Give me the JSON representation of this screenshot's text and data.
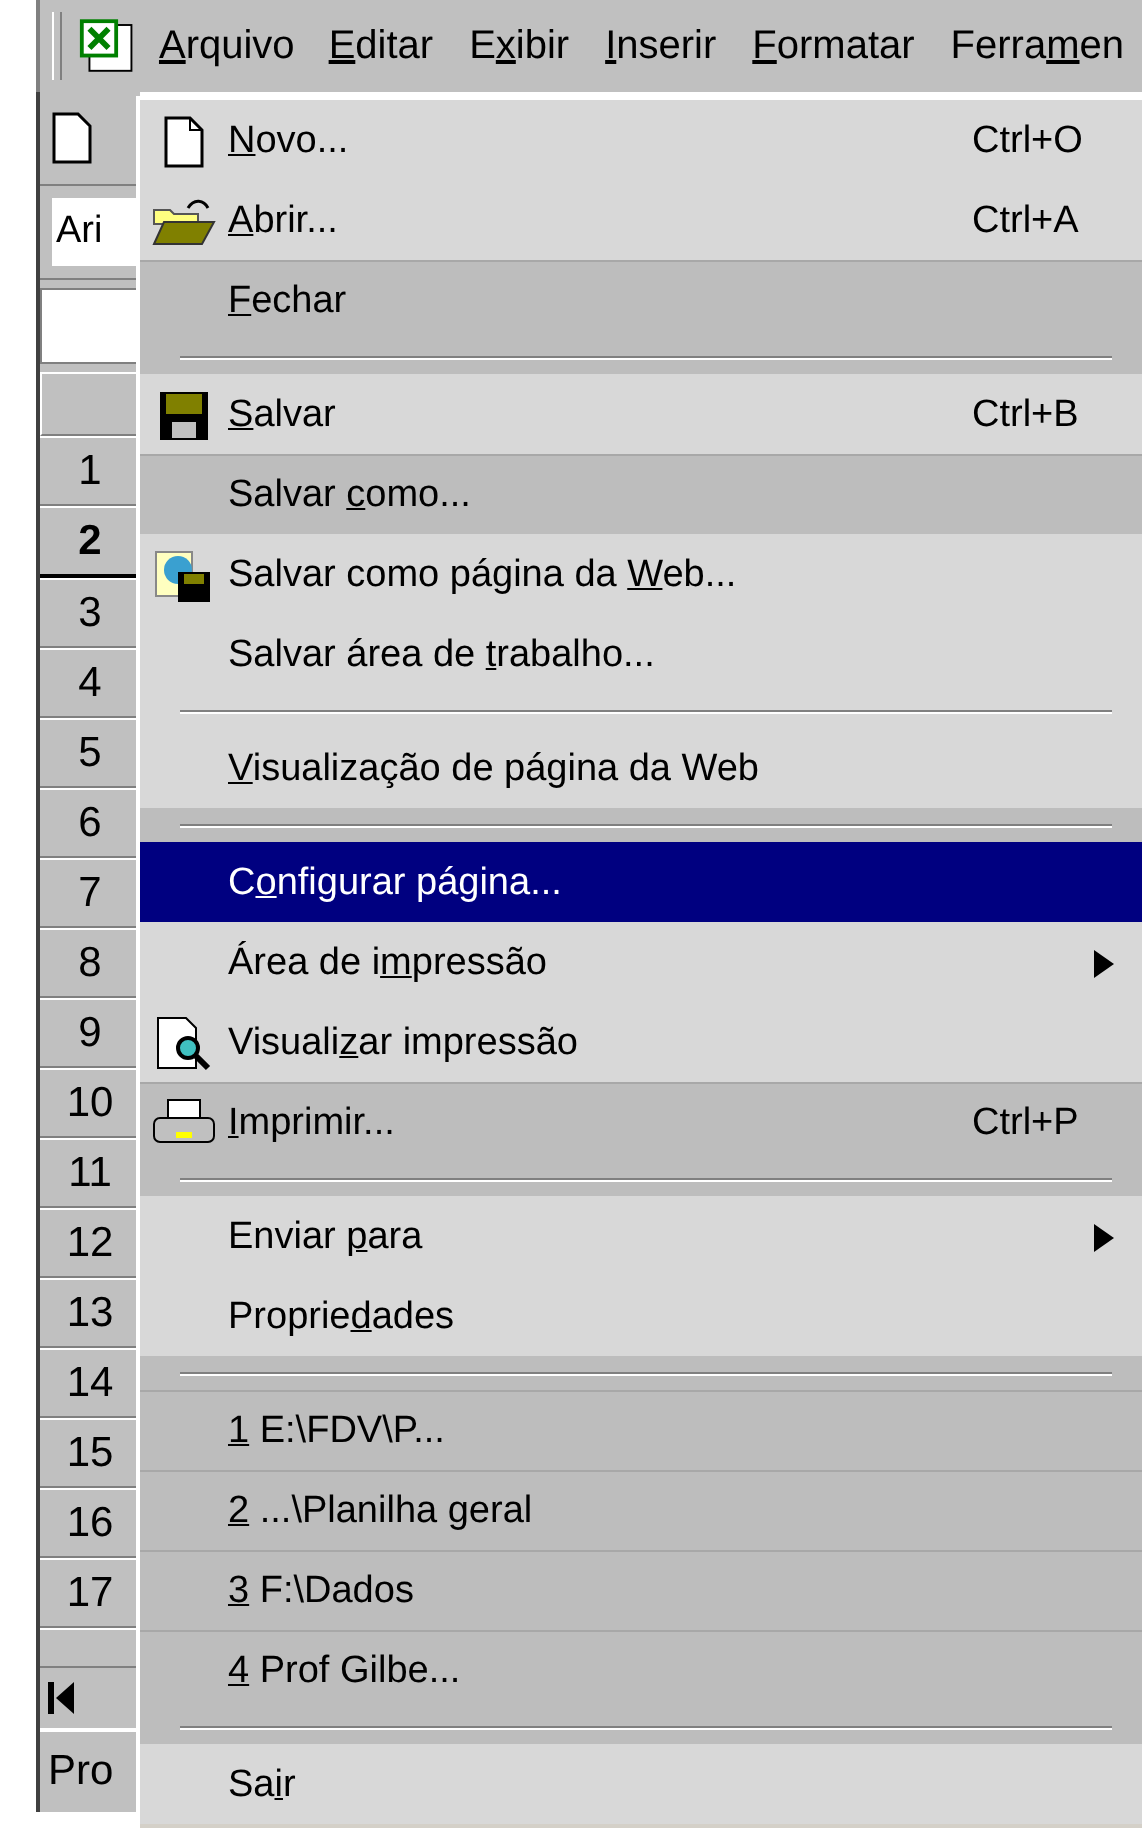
{
  "menu_bar": [
    {
      "key": "A",
      "after": "rquivo",
      "selected": true
    },
    {
      "key": "E",
      "after": "ditar",
      "selected": false
    },
    {
      "before": "E",
      "key": "x",
      "after": "ibir",
      "selected": false
    },
    {
      "key": "I",
      "after": "nserir",
      "selected": false
    },
    {
      "key": "F",
      "after": "ormatar",
      "selected": false
    },
    {
      "before": "Ferra",
      "key": "m",
      "after": "en",
      "selected": false
    }
  ],
  "background_window": {
    "font_box": "Ari",
    "rows": [
      {
        "label": "1",
        "selected": false
      },
      {
        "label": "2",
        "selected": true
      },
      {
        "label": "3",
        "selected": false
      },
      {
        "label": "4",
        "selected": false
      },
      {
        "label": "5",
        "selected": false
      },
      {
        "label": "6",
        "selected": false
      },
      {
        "label": "7",
        "selected": false
      },
      {
        "label": "8",
        "selected": false
      },
      {
        "label": "9",
        "selected": false
      },
      {
        "label": "10",
        "selected": false
      },
      {
        "label": "11",
        "selected": false
      },
      {
        "label": "12",
        "selected": false
      },
      {
        "label": "13",
        "selected": false
      },
      {
        "label": "14",
        "selected": false
      },
      {
        "label": "15",
        "selected": false
      },
      {
        "label": "16",
        "selected": false
      },
      {
        "label": "17",
        "selected": false
      }
    ],
    "status": "Pro"
  },
  "file_menu": [
    {
      "kind": "item",
      "key": "N",
      "after": "ovo...",
      "shortcut": "Ctrl+O",
      "extended": false,
      "selected": false,
      "submenu": false
    },
    {
      "kind": "item",
      "key": "A",
      "after": "brir...",
      "shortcut": "Ctrl+A",
      "extended": false,
      "selected": false,
      "submenu": false
    },
    {
      "kind": "item",
      "key": "F",
      "after": "echar",
      "extended": true,
      "selected": false,
      "submenu": false
    },
    {
      "kind": "separator",
      "extended": true
    },
    {
      "kind": "item",
      "key": "S",
      "after": "alvar",
      "shortcut": "Ctrl+B",
      "extended": false,
      "selected": false,
      "submenu": false
    },
    {
      "kind": "item",
      "before": "Salvar ",
      "key": "c",
      "after": "omo...",
      "extended": true,
      "selected": false,
      "submenu": false
    },
    {
      "kind": "item",
      "before": "Salvar como página da ",
      "key": "W",
      "after": "eb...",
      "extended": false,
      "selected": false,
      "submenu": false
    },
    {
      "kind": "item",
      "before": "Salvar área de ",
      "key": "t",
      "after": "rabalho...",
      "extended": false,
      "selected": false,
      "submenu": false
    },
    {
      "kind": "separator",
      "extended": false
    },
    {
      "kind": "item",
      "key": "V",
      "after": "isualização de página da Web",
      "extended": false,
      "selected": false,
      "submenu": false
    },
    {
      "kind": "separator",
      "extended": true
    },
    {
      "kind": "item",
      "before": "C",
      "key": "o",
      "after": "nfigurar página...",
      "extended": false,
      "selected": true,
      "submenu": false
    },
    {
      "kind": "item",
      "before": "Área de i",
      "key": "m",
      "after": "pressão",
      "extended": false,
      "selected": false,
      "submenu": true
    },
    {
      "kind": "item",
      "before": "Visuali",
      "key": "z",
      "after": "ar impressão",
      "extended": false,
      "selected": false,
      "submenu": false
    },
    {
      "kind": "item",
      "key": "I",
      "after": "mprimir...",
      "shortcut": "Ctrl+P",
      "extended": true,
      "selected": false,
      "submenu": false
    },
    {
      "kind": "separator",
      "extended": true
    },
    {
      "kind": "item",
      "before": "Enviar ",
      "key": "p",
      "after": "ara",
      "extended": false,
      "selected": false,
      "submenu": true
    },
    {
      "kind": "item",
      "before": "Proprie",
      "key": "d",
      "after": "ades",
      "extended": false,
      "selected": false,
      "submenu": false
    },
    {
      "kind": "separator",
      "extended": true
    },
    {
      "kind": "item",
      "key": "1",
      "after": " E:\\FDV\\P...",
      "extended": true,
      "selected": false,
      "submenu": false
    },
    {
      "kind": "item",
      "key": "2",
      "after": " ...\\Planilha geral",
      "extended": true,
      "selected": false,
      "submenu": false
    },
    {
      "kind": "item",
      "key": "3",
      "after": " F:\\Dados",
      "extended": true,
      "selected": false,
      "submenu": false
    },
    {
      "kind": "item",
      "key": "4",
      "after": " Prof Gilbe...",
      "extended": true,
      "selected": false,
      "submenu": false
    },
    {
      "kind": "separator",
      "extended": true
    },
    {
      "kind": "item",
      "before": "Sa",
      "key": "i",
      "after": "r",
      "extended": false,
      "selected": false,
      "submenu": false
    }
  ]
}
